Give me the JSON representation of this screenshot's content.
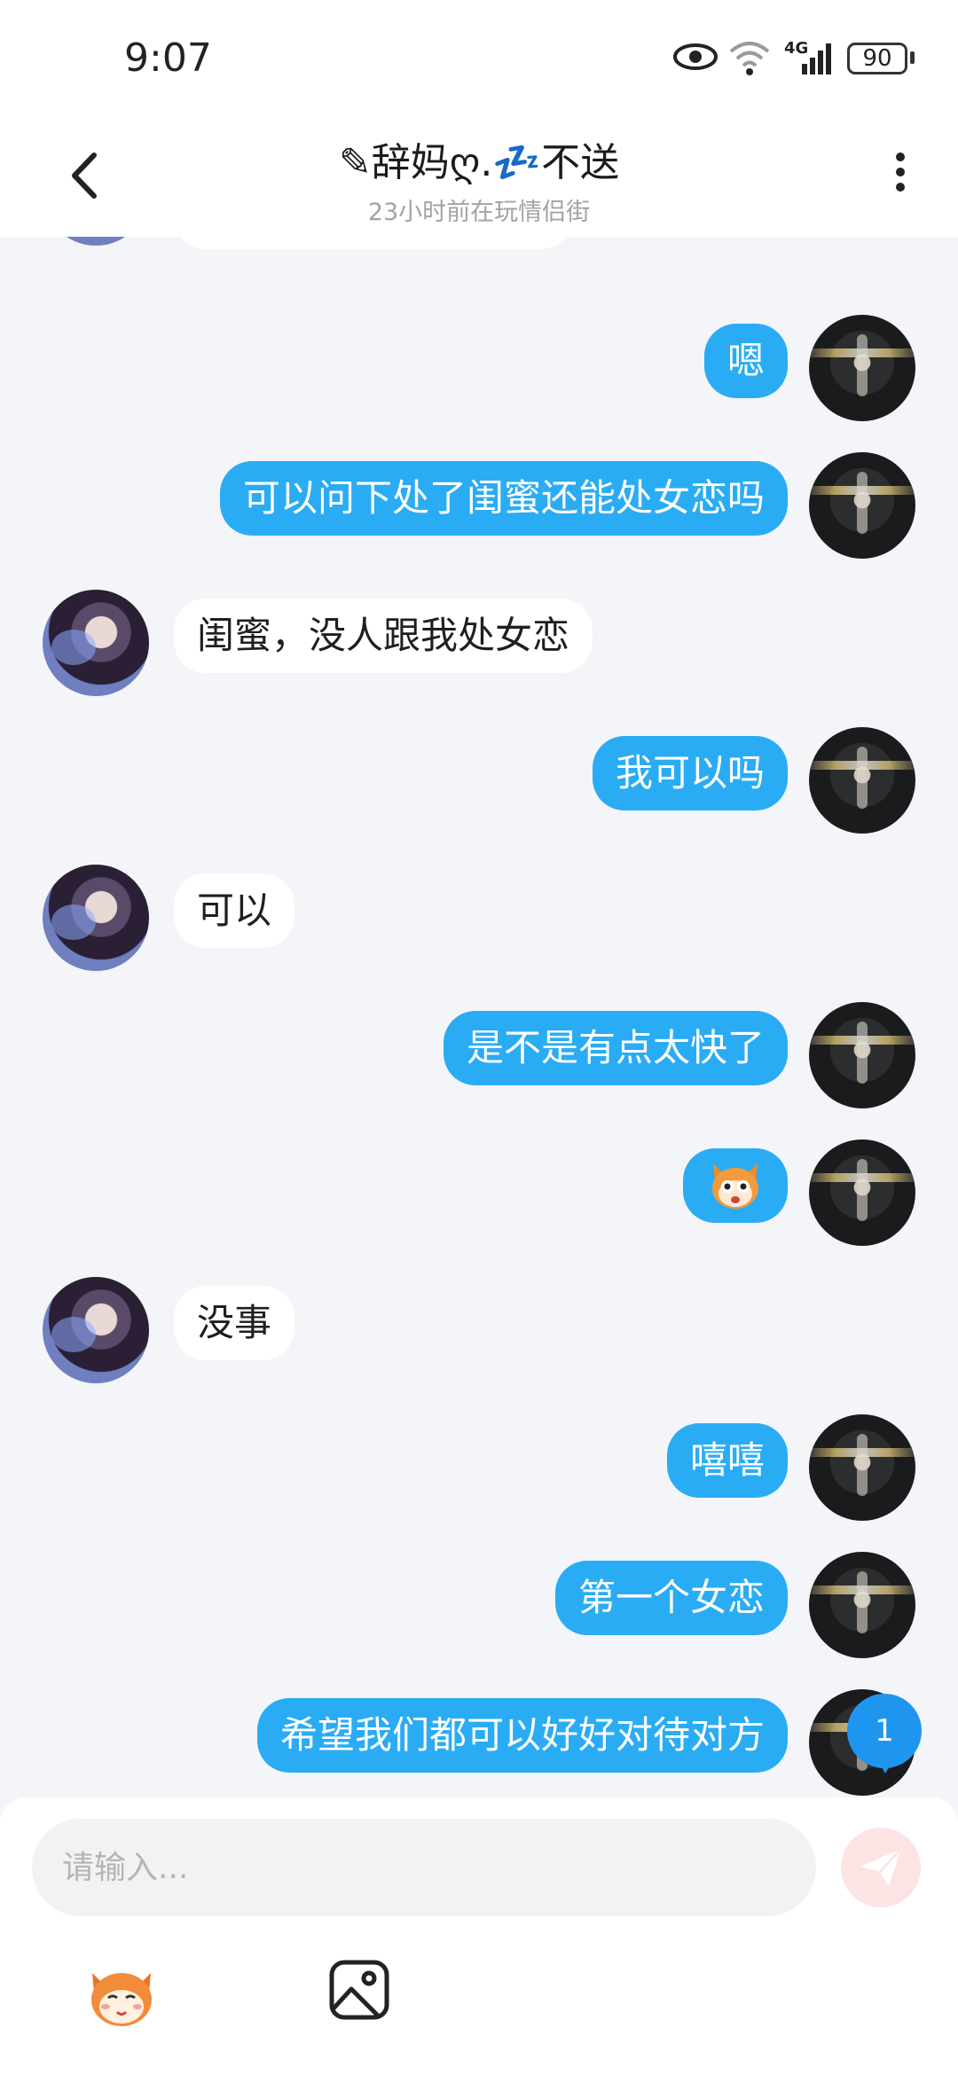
{
  "status_bar": {
    "time": "9:07",
    "network": "4G",
    "battery": "90"
  },
  "header": {
    "title": "✎辞妈ღ.💤不送",
    "subtitle": "23小时前在玩情侣街",
    "icons": {
      "back": "chevron-left-icon",
      "more": "more-vertical-icon"
    }
  },
  "messages": [
    {
      "side": "right",
      "text": "嗯"
    },
    {
      "side": "right",
      "text": "可以问下处了闺蜜还能处女恋吗"
    },
    {
      "side": "left",
      "text": "闺蜜，没人跟我处女恋"
    },
    {
      "side": "right",
      "text": "我可以吗"
    },
    {
      "side": "left",
      "text": "可以"
    },
    {
      "side": "right",
      "text": "是不是有点太快了"
    },
    {
      "side": "right",
      "sticker": "cartoon-face-sticker"
    },
    {
      "side": "left",
      "text": "没事"
    },
    {
      "side": "right",
      "text": "嘻嘻"
    },
    {
      "side": "right",
      "text": "第一个女恋"
    },
    {
      "side": "right",
      "text": "希望我们都可以好好对待对方"
    }
  ],
  "unread_count": "1",
  "input": {
    "placeholder": "请输入..."
  },
  "toolbar": {
    "icons": [
      "sticker-icon",
      "image-icon"
    ],
    "send_icon": "send-icon"
  },
  "colors": {
    "bubble_right": "#2aacf4",
    "bubble_left": "#ffffff",
    "background": "#f3f5f9",
    "badge": "#1e96f0"
  }
}
